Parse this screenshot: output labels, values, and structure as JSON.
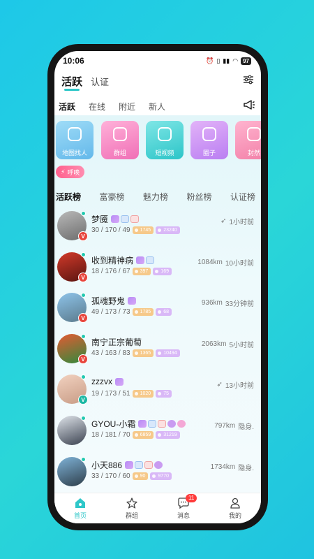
{
  "status_bar": {
    "time": "10:06",
    "battery": "97"
  },
  "header": {
    "tabs": [
      {
        "label": "活跃"
      },
      {
        "label": "认证"
      }
    ]
  },
  "subtabs": [
    {
      "label": "活跃"
    },
    {
      "label": "在线"
    },
    {
      "label": "附近"
    },
    {
      "label": "新人"
    }
  ],
  "shortcuts": [
    {
      "label": "地图找人",
      "icon": "map-pin-icon"
    },
    {
      "label": "群组",
      "icon": "chat-icon"
    },
    {
      "label": "短视频",
      "icon": "play-icon"
    },
    {
      "label": "圈子",
      "icon": "hashtag-icon"
    },
    {
      "label": "封然",
      "icon": "shop-icon"
    }
  ],
  "call_chip": {
    "label": "呼唤"
  },
  "rank_tabs": [
    {
      "label": "活跃榜"
    },
    {
      "label": "富豪榜"
    },
    {
      "label": "魅力榜"
    },
    {
      "label": "粉丝榜"
    },
    {
      "label": "认证榜"
    }
  ],
  "users": [
    {
      "name": "梦魇",
      "stats": "30 / 170 / 49",
      "coins": "1745",
      "likes": "23240",
      "distance": "",
      "time": "1小时前",
      "hidden_location": true,
      "badge_color": "#e8453c",
      "badge_letter": "V"
    },
    {
      "name": "收到精神病",
      "stats": "18 / 176 / 67",
      "coins": "397",
      "likes": "169",
      "distance": "1084km",
      "time": "10小时前",
      "hidden_location": false,
      "badge_color": "#e8453c",
      "badge_letter": "V"
    },
    {
      "name": "孤魂野鬼",
      "stats": "49 / 173 / 73",
      "coins": "1785",
      "likes": "68",
      "distance": "936km",
      "time": "33分钟前",
      "hidden_location": false,
      "badge_color": "#e8453c",
      "badge_letter": "V"
    },
    {
      "name": "南宁正宗葡萄",
      "stats": "43 / 163 / 83",
      "coins": "1365",
      "likes": "10494",
      "distance": "2063km",
      "time": "5小时前",
      "hidden_location": false,
      "badge_color": "#e8453c",
      "badge_letter": "V"
    },
    {
      "name": "zzzvx",
      "stats": "19 / 173 / 51",
      "coins": "1020",
      "likes": "75",
      "distance": "",
      "time": "13小时前",
      "hidden_location": true,
      "badge_color": "#1bb8a4",
      "badge_letter": "V"
    },
    {
      "name": "GYOU-小霜",
      "stats": "18 / 181 / 70",
      "coins": "6859",
      "likes": "31219",
      "distance": "797km",
      "time": "隐身.",
      "hidden_location": false,
      "badge_color": "",
      "badge_letter": ""
    },
    {
      "name": "小天886",
      "stats": "33 / 170 / 60",
      "coins": "90",
      "likes": "9770",
      "distance": "1734km",
      "time": "隐身.",
      "hidden_location": false,
      "badge_color": "",
      "badge_letter": ""
    }
  ],
  "tabbar": {
    "items": [
      {
        "label": "首页"
      },
      {
        "label": "群组"
      },
      {
        "label": "消息",
        "badge": "11"
      },
      {
        "label": "我的"
      }
    ]
  },
  "colors": {
    "accent": "#2fc7c9",
    "background": "#1ec8e8"
  }
}
